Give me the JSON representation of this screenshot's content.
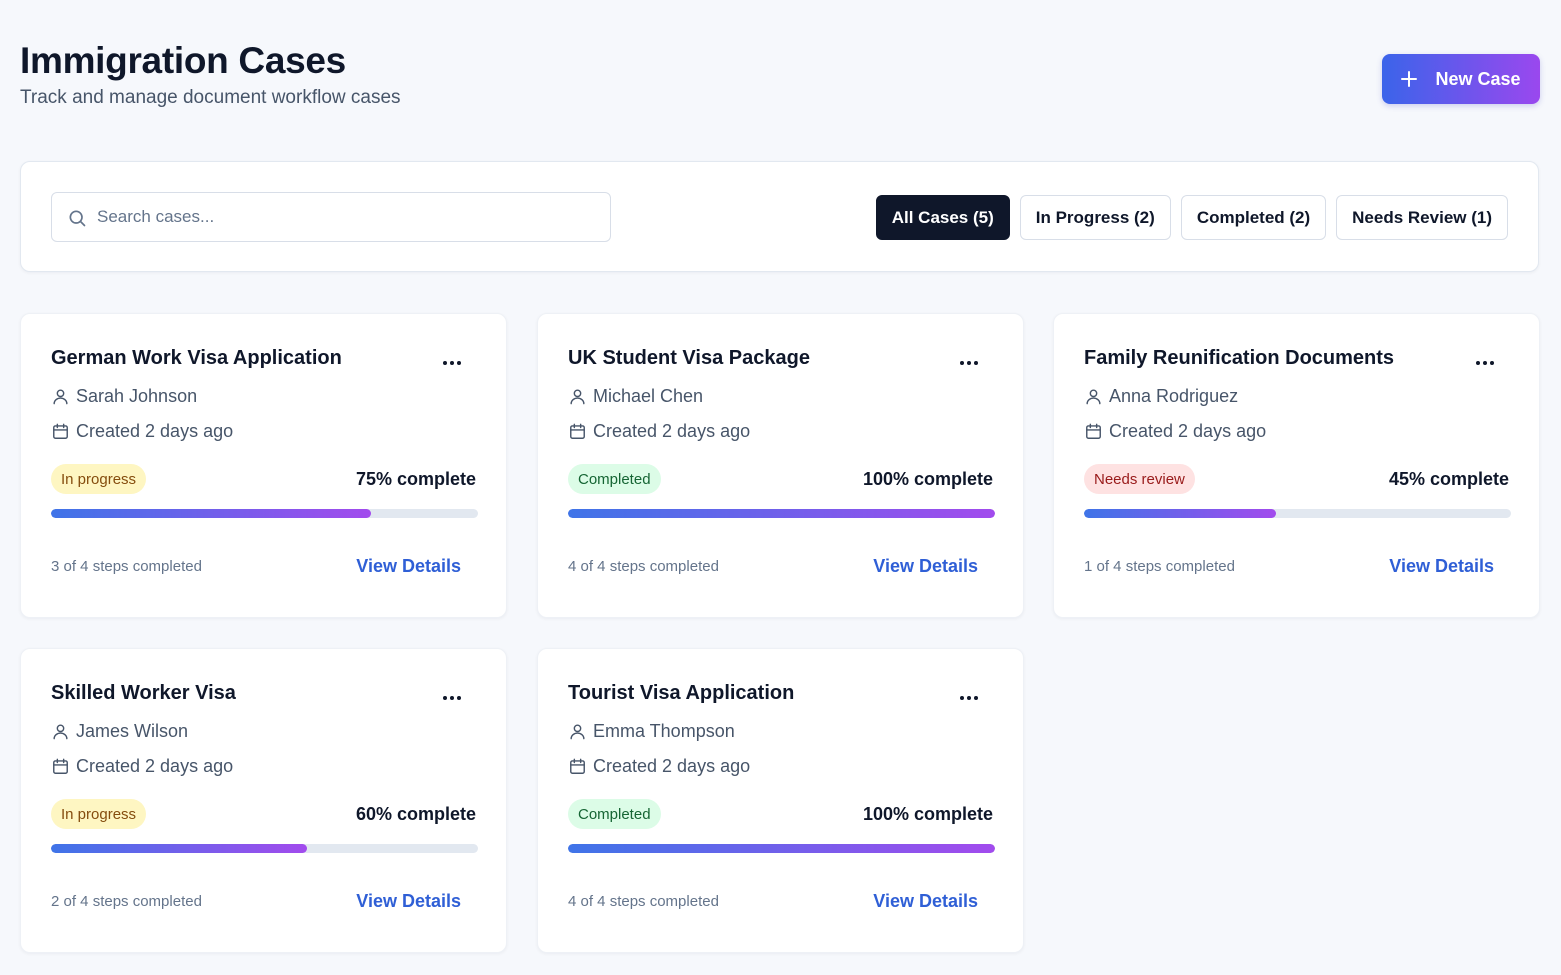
{
  "header": {
    "title": "Immigration Cases",
    "subtitle": "Track and manage document workflow cases",
    "new_case_label": "New Case"
  },
  "search": {
    "placeholder": "Search cases...",
    "value": ""
  },
  "filters": [
    {
      "label": "All Cases (5)",
      "active": true
    },
    {
      "label": "In Progress (2)",
      "active": false
    },
    {
      "label": "Completed (2)",
      "active": false
    },
    {
      "label": "Needs Review (1)",
      "active": false
    }
  ],
  "cases": [
    {
      "title": "German Work Visa Application",
      "client": "Sarah Johnson",
      "created": "Created 2 days ago",
      "status": "In progress",
      "status_key": "inprogress",
      "percent": 75,
      "percent_label": "75% complete",
      "steps": "3 of 4 steps completed",
      "action": "View Details"
    },
    {
      "title": "UK Student Visa Package",
      "client": "Michael Chen",
      "created": "Created 2 days ago",
      "status": "Completed",
      "status_key": "completed",
      "percent": 100,
      "percent_label": "100% complete",
      "steps": "4 of 4 steps completed",
      "action": "View Details"
    },
    {
      "title": "Family Reunification Documents",
      "client": "Anna Rodriguez",
      "created": "Created 2 days ago",
      "status": "Needs review",
      "status_key": "review",
      "percent": 45,
      "percent_label": "45% complete",
      "steps": "1 of 4 steps completed",
      "action": "View Details"
    },
    {
      "title": "Skilled Worker Visa",
      "client": "James Wilson",
      "created": "Created 2 days ago",
      "status": "In progress",
      "status_key": "inprogress",
      "percent": 60,
      "percent_label": "60% complete",
      "steps": "2 of 4 steps completed",
      "action": "View Details"
    },
    {
      "title": "Tourist Visa Application",
      "client": "Emma Thompson",
      "created": "Created 2 days ago",
      "status": "Completed",
      "status_key": "completed",
      "percent": 100,
      "percent_label": "100% complete",
      "steps": "4 of 4 steps completed",
      "action": "View Details"
    }
  ],
  "colors": {
    "accent_start": "#3b64ea",
    "accent_end": "#9a48ee",
    "link": "#2f5fd6",
    "active_filter": "#0f172a"
  }
}
